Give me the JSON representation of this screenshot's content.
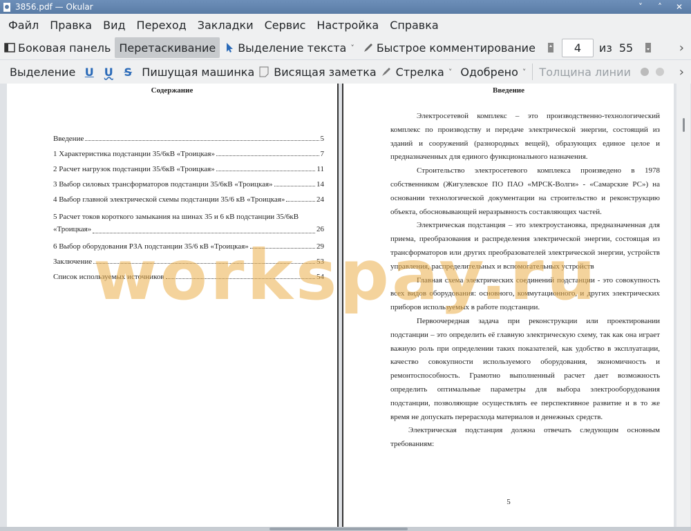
{
  "window": {
    "title": "3856.pdf  — Okular",
    "controls": [
      "˅",
      "˄",
      "✕"
    ]
  },
  "menu": [
    "Файл",
    "Правка",
    "Вид",
    "Переход",
    "Закладки",
    "Сервис",
    "Настройка",
    "Справка"
  ],
  "toolbar1": {
    "sidebar": "Боковая панель",
    "drag": "Перетаскивание",
    "text_select": "Выделение текста",
    "quick_comment": "Быстрое комментирование",
    "page_current": "4",
    "page_of": "из",
    "page_total": "55"
  },
  "toolbar2": {
    "select": "Выделение",
    "typewriter": "Пишущая машинка",
    "sticky": "Висящая заметка",
    "arrow": "Стрелка",
    "stamp": "Одобрено",
    "line_width": "Толщина линии"
  },
  "left_page": {
    "title": "Содержание",
    "toc": [
      {
        "text": "Введение",
        "page": "5"
      },
      {
        "text": "1 Характеристика подстанции 35/6кВ «Троицкая»",
        "page": "7"
      },
      {
        "text": "2 Расчет нагрузок подстанции 35/6кВ «Троицкая»",
        "page": "11"
      },
      {
        "text": "3 Выбор силовых трансформаторов подстанции 35/6кВ «Троицкая»",
        "page": "14"
      },
      {
        "text": "4 Выбор главной электрической схемы подстанции 35/6 кВ «Троицкая»",
        "page": "24"
      },
      {
        "line1": "5 Расчет токов короткого замыкания на шинах 35 и 6 кВ подстанции 35/6кВ",
        "text": "«Троицкая»",
        "page": "26"
      },
      {
        "text": "6 Выбор оборудования РЗА подстанции 35/6 кВ «Троицкая»",
        "page": "29"
      },
      {
        "text": "Заключение",
        "page": "53"
      },
      {
        "text": "Список используемых источников",
        "page": "54"
      }
    ]
  },
  "right_page": {
    "title": "Введение",
    "paragraphs": [
      "Электросетевой комплекс – это производственно-технологический комплекс по производству и передаче электрической энергии, состоящий из зданий и сооружений (разнородных вещей), образующих единое целое и предназначенных для единого функционального назначения.",
      "Строительство электросетевого комплекса произведено в 1978 собственником (Жигулевское ПО ПАО «МРСК-Волги» - «Самарские РС») на основании технологической документации на строительство и реконструкцию объекта, обосновывающей неразрывность составляющих частей.",
      "Электрическая подстанция – это электроустановка, предназначенная для приема, преобразования и распределения электрической энергии, состоящая из трансформаторов или других преобразователей электрической энергии, устройств управления, распределительных и вспомогательных устройств",
      "Главная схема электрических соединений подстанции - это совокупность всех видов оборудования: основного, коммутационного, и других электрических приборов используемых  в работе подстанции.",
      "Первоочередная задача при реконструкции или проектировании подстанции – это определить её главную электрическую схему, так как она играет важную роль при определении таких показателей, как удобство в эксплуатации, качество совокупности используемого оборудования, экономичность и ремонтоспособность. Грамотно выполненный расчет дает возможность определить оптимальные параметры для выбора электрооборудования подстанции, позволяющие осуществлять ее перспективное развитие и в то же время не допускать перерасхода материалов и денежных средств.",
      "Электрическая подстанция должна отвечать следующим основным требованиям:"
    ],
    "page_number": "5"
  },
  "watermark": "workspay.ru"
}
